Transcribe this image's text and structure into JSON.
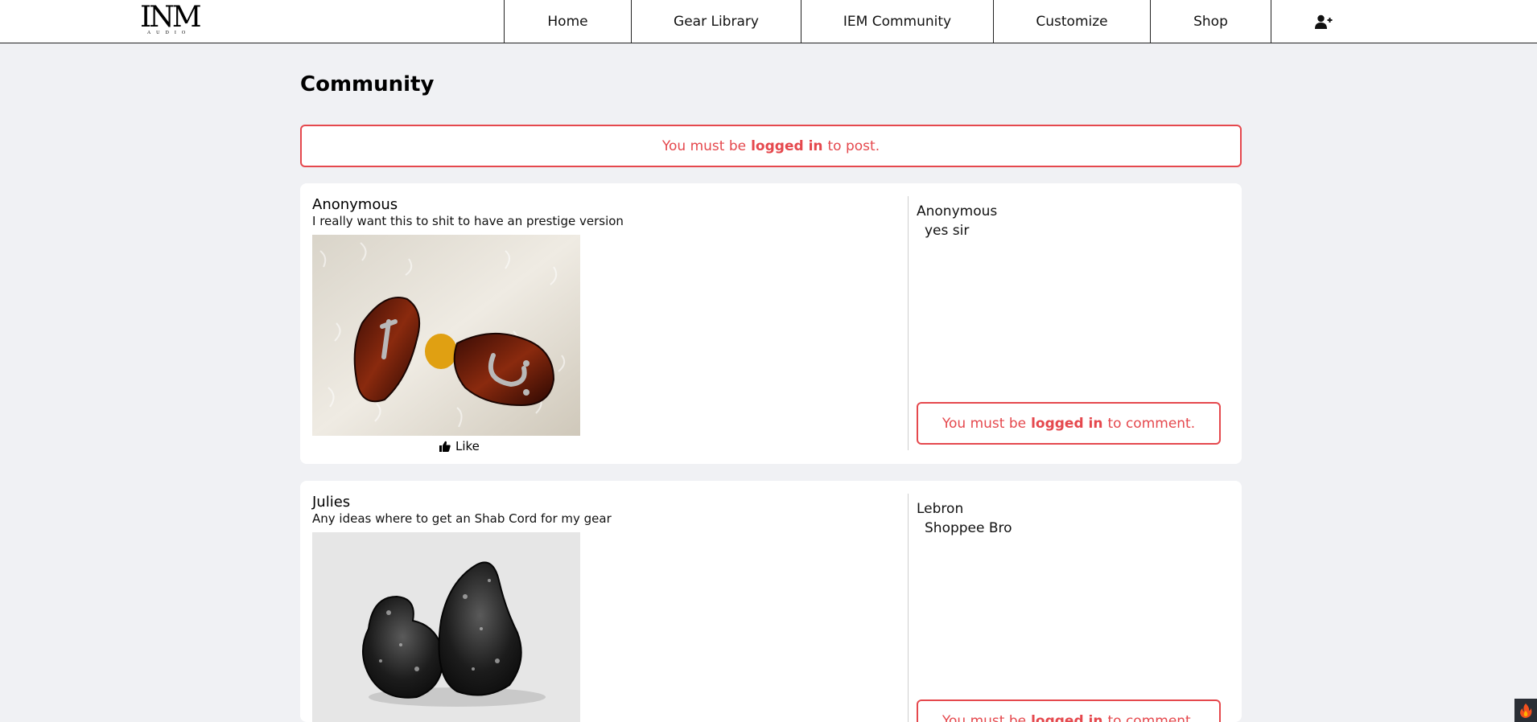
{
  "brand": {
    "logo_text": "INM",
    "logo_subtext": "AUDIO"
  },
  "nav": {
    "items": [
      "Home",
      "Gear Library",
      "IEM Community",
      "Customize",
      "Shop"
    ],
    "user_icon": "user-plus-icon"
  },
  "page": {
    "title": "Community"
  },
  "post_alert": {
    "prefix": "You must be",
    "emphasis": "logged in",
    "suffix": "to post."
  },
  "posts": [
    {
      "author": "Anonymous",
      "text": "I really want this to shit to have an prestige version",
      "image": "wood-shell-iem-photo",
      "like_label": "Like",
      "comments": [
        {
          "author": "Anonymous",
          "text": "yes sir"
        }
      ],
      "comment_alert": {
        "prefix": "You must be",
        "emphasis": "logged in",
        "suffix": "to comment."
      }
    },
    {
      "author": "Julies",
      "text": "Any ideas where to get an Shab Cord for my gear",
      "image": "black-marble-iem-photo",
      "comments": [
        {
          "author": "Lebron",
          "text": "Shoppee Bro"
        }
      ],
      "comment_alert": {
        "prefix": "You must be",
        "emphasis": "logged in",
        "suffix": "to comment."
      }
    }
  ],
  "colors": {
    "alert": "#e5484d",
    "background": "#f0f1f4",
    "card": "#ffffff"
  }
}
